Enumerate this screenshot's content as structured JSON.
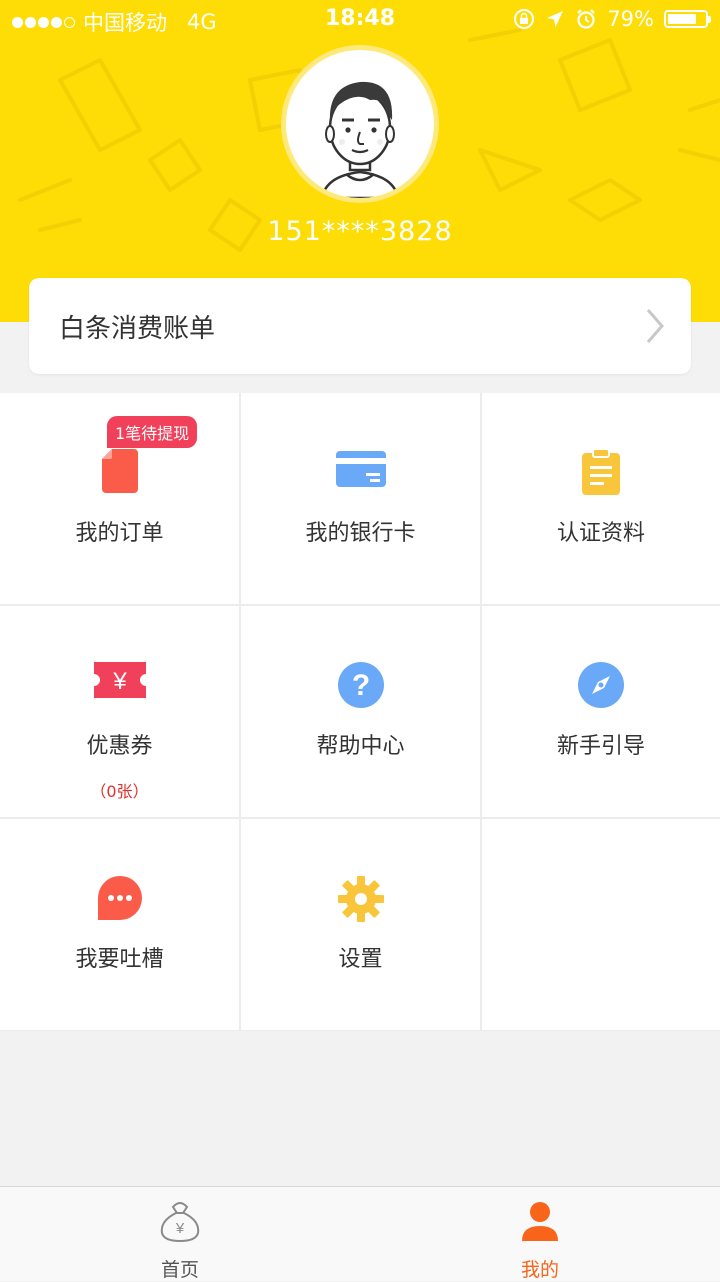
{
  "status_bar": {
    "carrier": "中国移动",
    "network": "4G",
    "time": "18:48",
    "battery": "79%",
    "battery_level": 0.79
  },
  "profile": {
    "phone": "151****3828"
  },
  "bill_card": {
    "label": "白条消费账单"
  },
  "grid": {
    "orders": {
      "label": "我的订单",
      "badge": "1笔待提现"
    },
    "bank_card": {
      "label": "我的银行卡"
    },
    "verification": {
      "label": "认证资料"
    },
    "coupons": {
      "label": "优惠券",
      "count": "（0张）"
    },
    "help": {
      "label": "帮助中心"
    },
    "guide": {
      "label": "新手引导"
    },
    "feedback": {
      "label": "我要吐槽"
    },
    "settings": {
      "label": "设置"
    }
  },
  "tabbar": {
    "home": "首页",
    "mine": "我的"
  },
  "colors": {
    "brand_yellow": "#fedc05",
    "active_tab": "#f8651a",
    "badge": "#f0405a",
    "icon_blue": "#6aa9f7",
    "icon_yellow": "#f9c53a",
    "icon_red": "#fb5c4a"
  }
}
